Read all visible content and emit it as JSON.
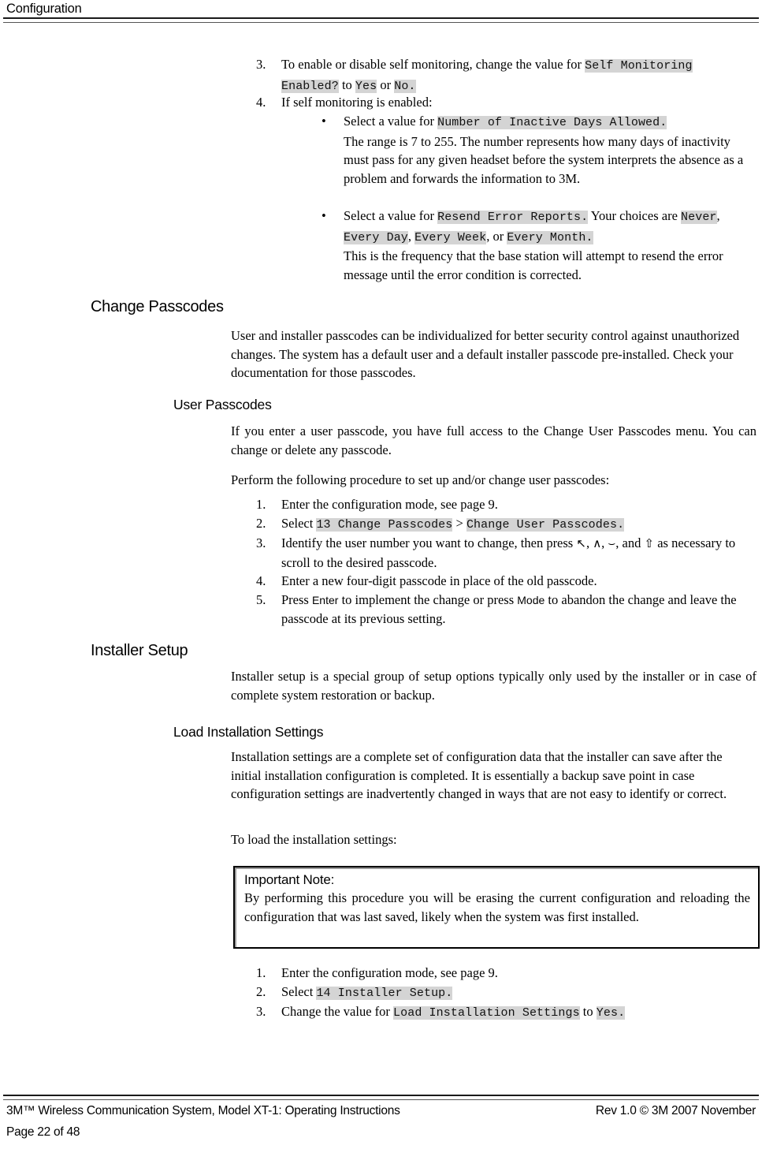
{
  "header": {
    "title": "Configuration"
  },
  "steps_top": {
    "item3": {
      "num": "3.",
      "t1": "To enable or disable self monitoring, change the value for ",
      "code1": "Self Monitoring Enabled?",
      "t2": " to ",
      "code2": "Yes",
      "t3": " or ",
      "code3": "No."
    },
    "item4": {
      "num": "4.",
      "text": "If self monitoring is enabled:",
      "bullets": [
        {
          "marker": "•",
          "lead": "Select a value for  ",
          "code": "Number of Inactive Days Allowed.",
          "rest": "The range is 7 to 255.  The number represents how many days of inactivity must pass for any given headset before the system interprets the absence as a problem and forwards the information to 3M."
        },
        {
          "marker": "•",
          "lead": "Select a value for ",
          "code": "Resend Error Reports.",
          "mid": " Your choices are ",
          "opt1": "Never",
          "sep1": ", ",
          "opt2": "Every Day",
          "sep2": ", ",
          "opt3": "Every Week",
          "sep3": ", or ",
          "opt4": "Every Month.",
          "rest": "This is the frequency that the base station will attempt to resend the error message until the error condition is corrected."
        }
      ]
    }
  },
  "change_passcodes": {
    "heading": "Change Passcodes",
    "paragraph": "User and installer passcodes can be individualized for better security control against unauthorized changes.  The system has a default user and a default installer passcode pre-installed.  Check your documentation for those passcodes."
  },
  "user_passcodes": {
    "heading": "User Passcodes",
    "paragraph1": "If you enter a user passcode, you have full access to the Change User Passcodes menu.  You can change or delete any passcode.",
    "paragraph2": "Perform the following procedure to set up and/or change user passcodes:",
    "steps": {
      "s1": {
        "num": "1.",
        "text": "Enter the configuration mode, see page 9."
      },
      "s2": {
        "num": "2.",
        "lead": "Select ",
        "code1": "13 Change Passcodes",
        "gt": " > ",
        "code2": "Change User Passcodes."
      },
      "s3": {
        "num": "3.",
        "lead": "Identify the user number you want to change, then press ",
        "sym1": "↖",
        "sep1": ", ",
        "sym2": "∧",
        "sep2": ", ",
        "sym3": "⌣",
        "sep3": ", and ",
        "sym4": "⇧",
        "tail": " as necessary to scroll to the desired passcode."
      },
      "s4": {
        "num": "4.",
        "text": "Enter a new four-digit passcode in place of the old passcode."
      },
      "s5": {
        "num": "5.",
        "lead": "Press ",
        "key1": "Enter",
        "mid": " to implement the change or press ",
        "key2": "Mode",
        "tail": " to abandon the change and leave the passcode at its previous setting."
      }
    }
  },
  "installer_setup": {
    "heading": "Installer Setup",
    "paragraph": "Installer setup is a special group of setup options typically only used by the installer or in case of complete system restoration or backup."
  },
  "load_installation_settings": {
    "heading": "Load Installation Settings",
    "paragraph1": "Installation settings are a complete set of configuration data that the installer can save after the initial installation configuration is completed.  It is essentially a backup save point in case configuration settings are inadvertently changed in ways that are not easy to identify or correct.",
    "paragraph2": "To load the installation settings:",
    "note": {
      "title": "Important Note:",
      "body": "By performing this procedure you will be erasing the current configuration and reloading the configuration that was last saved, likely when the system was first installed."
    },
    "steps": {
      "s1": {
        "num": "1.",
        "text": "Enter the configuration mode, see page 9."
      },
      "s2": {
        "num": "2.",
        "lead": "Select ",
        "code1": "14 Installer Setup."
      },
      "s3": {
        "num": "3.",
        "lead": "Change the value for  ",
        "code1": "Load Installation Settings",
        "mid": " to ",
        "code2": "Yes."
      }
    }
  },
  "footer": {
    "left": "3M™ Wireless Communication System, Model XT-1: Operating Instructions",
    "right": "Rev 1.0 © 3M 2007 November",
    "page": "Page 22 of 48"
  }
}
